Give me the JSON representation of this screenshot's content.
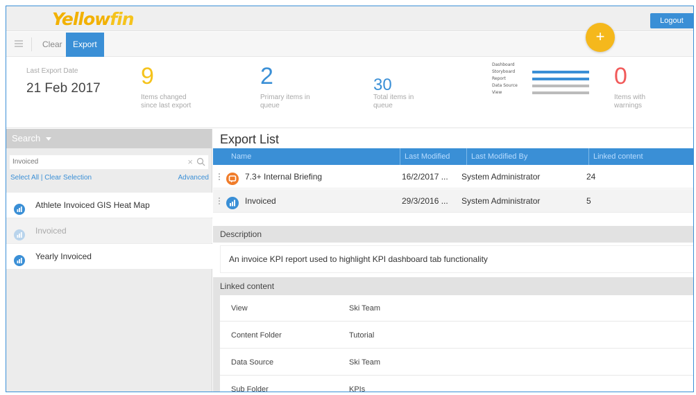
{
  "header": {
    "logo_part1": "Yellow",
    "logo_part2": "fin",
    "logout_label": "Logout"
  },
  "toolbar": {
    "clear_label": "Clear",
    "export_label": "Export",
    "fab_label": "+"
  },
  "stats": {
    "last_export_label": "Last Export Date",
    "last_export_date": "21 Feb 2017",
    "items_changed_count": "9",
    "items_changed_label_1": "Items changed",
    "items_changed_label_2": "since last export",
    "primary_count": "2",
    "primary_label_1": "Primary items in",
    "primary_label_2": "queue",
    "total_count": "30",
    "total_label_1": "Total items in",
    "total_label_2": "queue",
    "warnings_count": "0",
    "warnings_label_1": "Items with",
    "warnings_label_2": "warnings",
    "bar_legend": [
      {
        "label": "Dashboard",
        "fill": 0,
        "color": "#cccccc"
      },
      {
        "label": "Storyboard",
        "fill": 1,
        "color": "#3a8fd6"
      },
      {
        "label": "Report",
        "fill": 1,
        "color": "#3a8fd6"
      },
      {
        "label": "Data Source",
        "fill": 1,
        "color": "#bbbbbb"
      },
      {
        "label": "View",
        "fill": 1,
        "color": "#bbbbbb"
      }
    ]
  },
  "search": {
    "heading": "Search",
    "input_value": "Invoiced",
    "select_links": "Select All | Clear Selection",
    "advanced": "Advanced",
    "results": [
      {
        "label": "Athlete Invoiced GIS Heat Map",
        "state": "normal"
      },
      {
        "label": "Invoiced",
        "state": "disabled"
      },
      {
        "label": "Yearly Invoiced",
        "state": "normal"
      }
    ]
  },
  "export_list": {
    "title": "Export List",
    "columns": [
      "Name",
      "Last Modified",
      "Last Modified By",
      "Linked content"
    ],
    "rows": [
      {
        "name": "7.3+ Internal Briefing",
        "modified": "16/2/2017 ...",
        "by": "System Administrator",
        "linked": "24",
        "icon": "storyboard-icon"
      },
      {
        "name": "Invoiced",
        "modified": "29/3/2016 ...",
        "by": "System Administrator",
        "linked": "5",
        "icon": "report-icon"
      }
    ],
    "description_heading": "Description",
    "description_text": "An invoice KPI report used to highlight KPI dashboard tab functionality",
    "linked_heading": "Linked content",
    "linked": [
      {
        "key": "View",
        "value": "Ski Team"
      },
      {
        "key": "Content Folder",
        "value": "Tutorial"
      },
      {
        "key": "Data Source",
        "value": "Ski Team"
      },
      {
        "key": "Sub Folder",
        "value": "KPIs"
      }
    ]
  },
  "colors": {
    "accent": "#3a8fd6",
    "brand_yellow": "#f5c31c",
    "warning_red": "#f15a5a",
    "storyboard_orange": "#f07c2a"
  }
}
